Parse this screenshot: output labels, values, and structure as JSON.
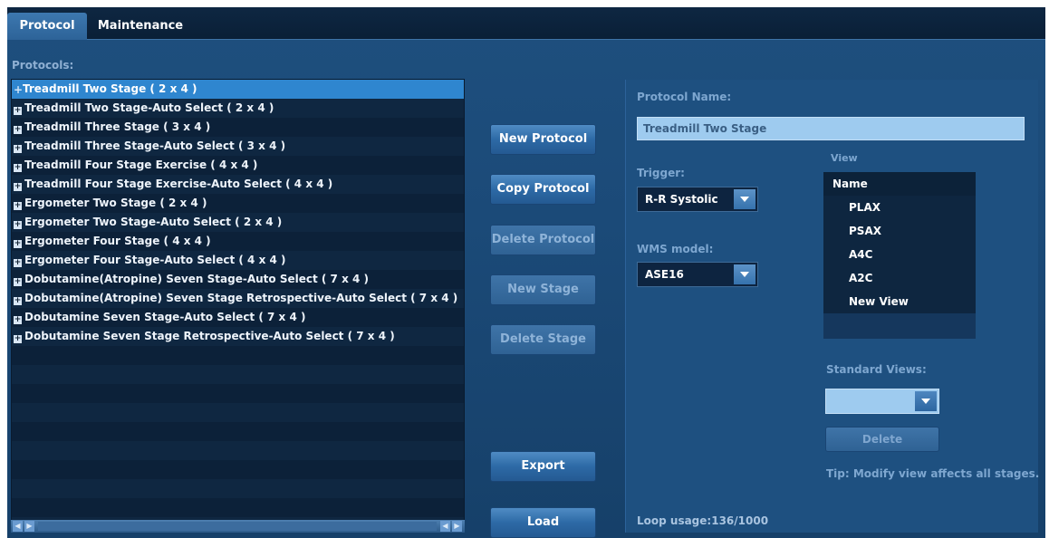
{
  "tabs": [
    {
      "label": "Protocol",
      "active": true
    },
    {
      "label": "Maintenance",
      "active": false
    }
  ],
  "protocols_label": "Protocols:",
  "protocols": [
    "Treadmill Two Stage ( 2 x 4 )",
    "Treadmill Two Stage-Auto Select ( 2 x 4 )",
    "Treadmill Three Stage ( 3 x 4 )",
    "Treadmill Three Stage-Auto Select ( 3 x 4 )",
    "Treadmill Four Stage Exercise ( 4 x 4 )",
    "Treadmill Four Stage Exercise-Auto Select ( 4 x 4 )",
    "Ergometer Two Stage ( 2 x 4 )",
    "Ergometer Two Stage-Auto Select ( 2 x 4 )",
    "Ergometer Four Stage ( 4 x 4 )",
    "Ergometer Four Stage-Auto Select ( 4 x 4 )",
    "Dobutamine(Atropine) Seven Stage-Auto Select ( 7 x 4 )",
    "Dobutamine(Atropine) Seven Stage Retrospective-Auto Select ( 7 x 4 )",
    "Dobutamine Seven Stage-Auto Select ( 7 x 4 )",
    "Dobutamine Seven Stage Retrospective-Auto Select ( 7 x 4 )"
  ],
  "selected_protocol_index": 0,
  "buttons": {
    "new_protocol": "New Protocol",
    "copy_protocol": "Copy Protocol",
    "delete_protocol": "Delete Protocol",
    "new_stage": "New Stage",
    "delete_stage": "Delete Stage",
    "export": "Export",
    "load": "Load"
  },
  "details": {
    "protocol_name_label": "Protocol Name:",
    "protocol_name_value": "Treadmill Two Stage",
    "trigger_label": "Trigger:",
    "trigger_value": "R-R Systolic",
    "wms_label": "WMS model:",
    "wms_value": "ASE16",
    "view_label": "View",
    "view_header": "Name",
    "views": [
      "PLAX",
      "PSAX",
      "A4C",
      "A2C",
      "New View"
    ],
    "standard_views_label": "Standard Views:",
    "standard_views_value": "",
    "delete_label": "Delete",
    "tip": "Tip: Modify view affects all stages.",
    "loop_usage": "Loop usage:136/1000"
  }
}
